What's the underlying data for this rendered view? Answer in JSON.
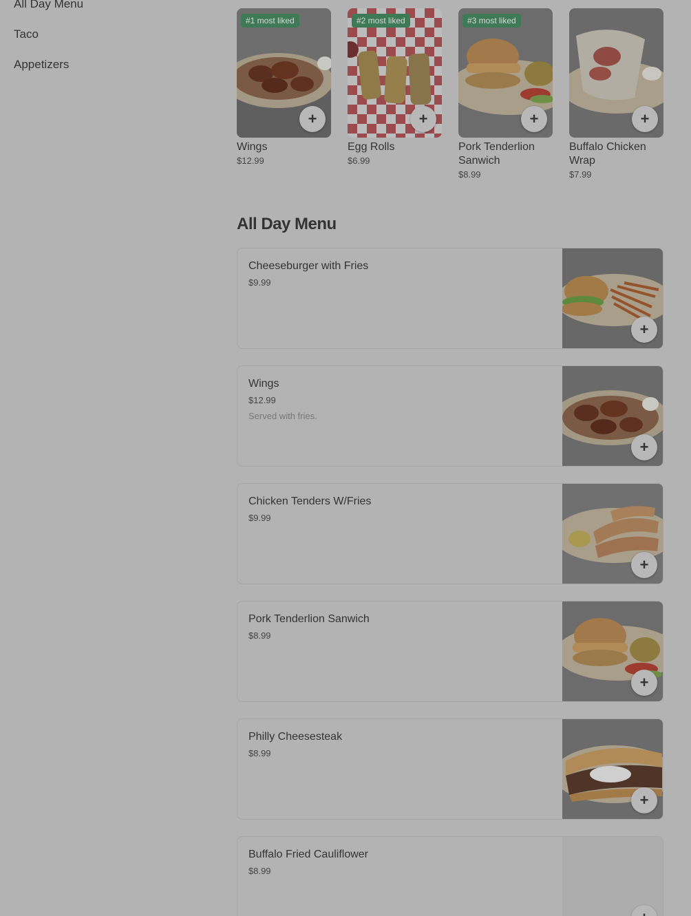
{
  "sidebar": {
    "items": [
      {
        "label": "All Day Menu"
      },
      {
        "label": "Taco"
      },
      {
        "label": "Appetizers"
      }
    ]
  },
  "popular": [
    {
      "badge": "#1 most liked",
      "name": "Wings",
      "price": "$12.99"
    },
    {
      "badge": "#2 most liked",
      "name": "Egg Rolls",
      "price": "$6.99"
    },
    {
      "badge": "#3 most liked",
      "name": "Pork Tenderlion Sanwich",
      "price": "$8.99"
    },
    {
      "badge": "",
      "name": "Buffalo Chicken Wrap",
      "price": "$7.99"
    }
  ],
  "section": {
    "title": "All Day Menu"
  },
  "items": [
    {
      "name": "Cheeseburger with Fries",
      "price": "$9.99",
      "desc": ""
    },
    {
      "name": "Wings",
      "price": "$12.99",
      "desc": "Served with fries."
    },
    {
      "name": "Chicken Tenders W/Fries",
      "price": "$9.99",
      "desc": ""
    },
    {
      "name": "Pork Tenderlion Sanwich",
      "price": "$8.99",
      "desc": ""
    },
    {
      "name": "Philly Cheesesteak",
      "price": "$8.99",
      "desc": ""
    },
    {
      "name": "Buffalo Fried Cauliflower",
      "price": "$8.99",
      "desc": ""
    }
  ],
  "add_symbol": "+",
  "colors": {
    "badge": "#3f7a56",
    "overlay": "#b3b3b3"
  }
}
